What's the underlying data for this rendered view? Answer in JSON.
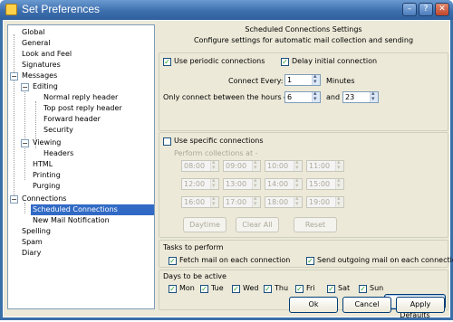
{
  "window": {
    "title": "Set Preferences",
    "min": "–",
    "help": "?",
    "close": "✕"
  },
  "tree": {
    "global": "Global",
    "general": "General",
    "look": "Look and Feel",
    "signatures": "Signatures",
    "messages": "Messages",
    "editing": "Editing",
    "normal_reply": "Normal reply header",
    "top_post": "Top post reply header",
    "forward": "Forward header",
    "security": "Security",
    "viewing": "Viewing",
    "headers": "Headers",
    "html": "HTML",
    "printing": "Printing",
    "purging": "Purging",
    "connections": "Connections",
    "scheduled": "Scheduled Connections",
    "new_mail": "New Mail Notification",
    "spelling": "Spelling",
    "spam": "Spam",
    "diary": "Diary",
    "collapse": "−"
  },
  "header": {
    "title": "Scheduled Connections Settings",
    "subtitle": "Configure settings for automatic mail collection and sending"
  },
  "periodic": {
    "use_periodic": "Use periodic connections",
    "delay": "Delay initial connection",
    "connect_every": "Connect Every:",
    "every_value": "1",
    "minutes": "Minutes",
    "between": "Only connect between the hours of:",
    "from": "6",
    "and": "and",
    "to": "23"
  },
  "specific": {
    "label": "Use specific connections",
    "perform": "Perform collections at -",
    "times": [
      "08:00",
      "09:00",
      "10:00",
      "11:00",
      "12:00",
      "13:00",
      "14:00",
      "15:00",
      "16:00",
      "17:00",
      "18:00",
      "19:00"
    ],
    "daytime": "Daytime",
    "clear_all": "Clear All",
    "reset": "Reset"
  },
  "tasks": {
    "title": "Tasks to perform",
    "fetch": "Fetch mail on each connection",
    "send": "Send outgoing mail on each connection"
  },
  "days": {
    "title": "Days to be active",
    "list": [
      "Mon",
      "Tue",
      "Wed",
      "Thu",
      "Fri",
      "Sat",
      "Sun"
    ],
    "restore": "Restore Defaults"
  },
  "footer": {
    "ok": "Ok",
    "cancel": "Cancel",
    "apply": "Apply"
  },
  "check_mark": "✓",
  "colors": {
    "selection": "#316ac5",
    "titlebar": "#3d6fae",
    "panel_bg": "#ece9d8"
  }
}
